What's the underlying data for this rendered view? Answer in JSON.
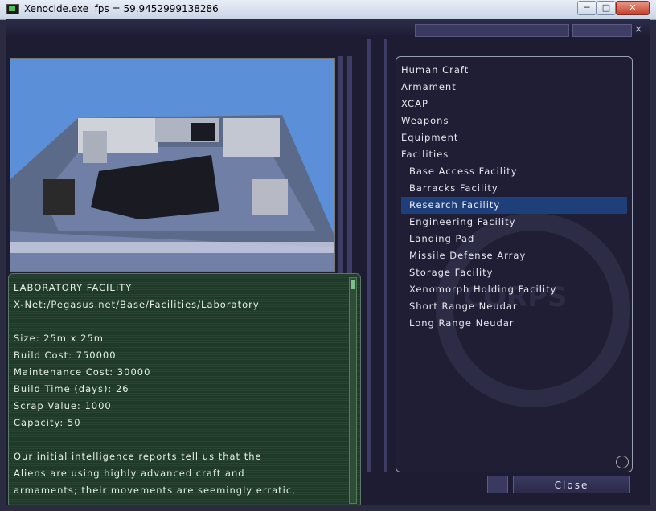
{
  "window": {
    "title": "Xenocide.exe  fps = 59.9452999138286",
    "controls": {
      "minimize": "─",
      "maximize": "□",
      "close": "✕"
    }
  },
  "inner_close": "×",
  "lab": {
    "lines": [
      "LABORATORY FACILITY",
      "X-Net:/Pegasus.net/Base/Facilities/Laboratory",
      "",
      "Size: 25m x 25m",
      "Build Cost: 750000",
      "Maintenance Cost: 30000",
      "Build Time (days): 26",
      "Scrap Value: 1000",
      "Capacity: 50",
      "",
      "Our initial intelligence reports tell us that the",
      "Aliens are using highly advanced craft and",
      "armaments; their movements are seemingly erratic,"
    ]
  },
  "menu": {
    "items": [
      {
        "label": "Human Craft",
        "sub": false
      },
      {
        "label": "Armament",
        "sub": false
      },
      {
        "label": "XCAP",
        "sub": false
      },
      {
        "label": "Weapons",
        "sub": false
      },
      {
        "label": "Equipment",
        "sub": false
      },
      {
        "label": "Facilities",
        "sub": false
      },
      {
        "label": "Base Access Facility",
        "sub": true
      },
      {
        "label": "Barracks Facility",
        "sub": true
      },
      {
        "label": "Research Facility",
        "sub": true,
        "selected": true
      },
      {
        "label": "Engineering Facility",
        "sub": true
      },
      {
        "label": "Landing Pad",
        "sub": true
      },
      {
        "label": "Missile Defense Array",
        "sub": true
      },
      {
        "label": "Storage Facility",
        "sub": true
      },
      {
        "label": "Xenomorph Holding Facility",
        "sub": true
      },
      {
        "label": "Short Range Neudar",
        "sub": true
      },
      {
        "label": "Long Range Neudar",
        "sub": true
      }
    ]
  },
  "close_label": "Close",
  "colors": {
    "selected": "#1e3f7a",
    "panel": "#1f3a28",
    "frame": "#1d1c33"
  }
}
